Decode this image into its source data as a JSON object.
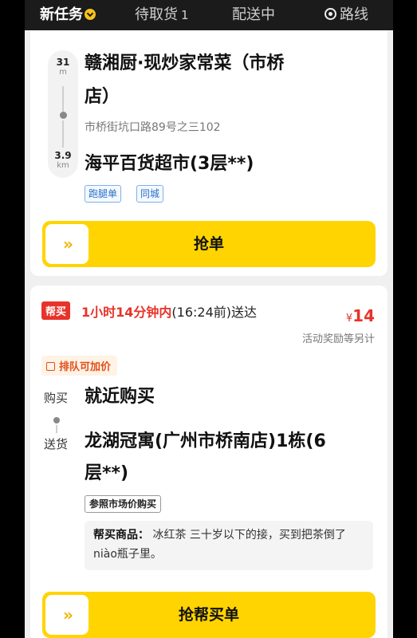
{
  "tabs": [
    {
      "label": "新任务",
      "active": true
    },
    {
      "label": "待取货",
      "count": "1"
    },
    {
      "label": "配送中"
    },
    {
      "label": "路线",
      "icon": "route-icon"
    }
  ],
  "order1": {
    "distance_top": {
      "value": "31",
      "unit": "m"
    },
    "distance_bottom": {
      "value": "3.9",
      "unit": "km"
    },
    "pickup_name_line1": "赣湘厨·现炒家常菜（市桥",
    "pickup_name_line2": "店）",
    "pickup_address": "市桥街坑口路89号之三102",
    "dropoff_name": "海平百货超市(3层**)",
    "tags": [
      "跑腿单",
      "同城"
    ],
    "grab_label": "抢单"
  },
  "order2": {
    "type_badge": "帮买",
    "time_highlight": "1小时14分钟内",
    "time_rest": "(16:24前)送达",
    "price_symbol": "¥",
    "price_value": "14",
    "price_note": "活动奖励等另计",
    "queue_tag": "排队可加价",
    "buy_label": "购买",
    "buy_location": "就近购买",
    "deliver_label": "送货",
    "deliver_line1": "龙湖冠寓(广州市桥南店)1栋(6",
    "deliver_line2": "层**)",
    "price_tag": "参照市场价购买",
    "goods_label": "帮买商品：",
    "goods_text": " 冰红茶 三十岁以下的接，买到把茶倒了niào瓶子里。",
    "grab_label": "抢帮买单"
  },
  "colors": {
    "accent": "#ffd400",
    "alert": "#e8332a",
    "link": "#2470c9"
  }
}
